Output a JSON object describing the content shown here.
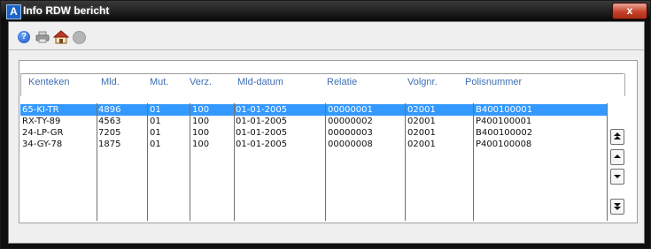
{
  "window": {
    "title": "Info RDW bericht",
    "close_label": "x"
  },
  "toolbar": {
    "icons": [
      "help-icon",
      "print-icon",
      "home-icon",
      "info-icon"
    ],
    "help_glyph": "?"
  },
  "table": {
    "columns": [
      "Kenteken",
      "Mld.",
      "Mut.",
      "Verz.",
      "Mld-datum",
      "Relatie",
      "Volgnr.",
      "Polisnummer"
    ],
    "rows": [
      [
        "65-KI-TR",
        "4896",
        "01",
        "100",
        "01-01-2005",
        "00000001",
        "02001",
        "B400100001"
      ],
      [
        "RX-TY-89",
        "4563",
        "01",
        "100",
        "01-01-2005",
        "00000002",
        "02001",
        "P400100001"
      ],
      [
        "24-LP-GR",
        "7205",
        "01",
        "100",
        "01-01-2005",
        "00000003",
        "02001",
        "B400100002"
      ],
      [
        "34-GY-78",
        "1875",
        "01",
        "100",
        "01-01-2005",
        "00000008",
        "02001",
        "P400100008"
      ]
    ],
    "selected_row": 0
  },
  "colors": {
    "selection": "#3399ff",
    "header_text": "#3d6fb4",
    "close_button": "#c8412a"
  }
}
